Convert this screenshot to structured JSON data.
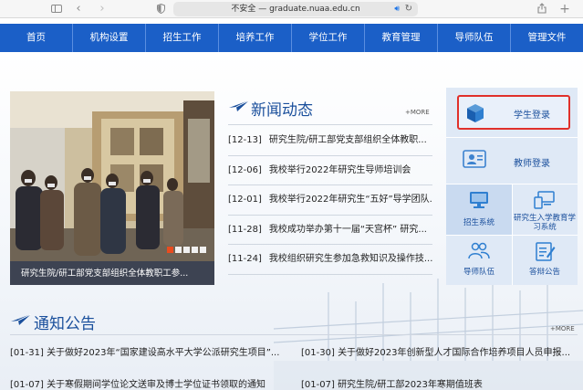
{
  "browser": {
    "security_label": "不安全",
    "separator": "—",
    "domain": "graduate.nuaa.edu.cn"
  },
  "nav": {
    "items": [
      "首页",
      "机构设置",
      "招生工作",
      "培养工作",
      "学位工作",
      "教育管理",
      "导师队伍",
      "管理文件"
    ]
  },
  "carousel": {
    "caption": "研究生院/研工部党支部组织全体教职工参...",
    "slide_count": 5,
    "active_slide": 1
  },
  "news": {
    "title": "新闻动态",
    "more": "+MORE",
    "items": [
      {
        "date": "[12-13]",
        "text": "研究生院/研工部党支部组织全体教职..."
      },
      {
        "date": "[12-06]",
        "text": "我校举行2022年研究生导师培训会"
      },
      {
        "date": "[12-01]",
        "text": "我校举行2022年研究生“五好”导学团队..."
      },
      {
        "date": "[11-28]",
        "text": "我校成功举办第十一届“天宫杯” 研究..."
      },
      {
        "date": "[11-24]",
        "text": "我校组织研究生参加急救知识及操作技..."
      }
    ]
  },
  "quick_links": {
    "student_login": "学生登录",
    "teacher_login": "教师登录",
    "grid": [
      "招生系统",
      "研究生入学教育学习系统",
      "导师队伍",
      "答辩公告"
    ]
  },
  "notices": {
    "title": "通知公告",
    "more": "+MORE",
    "items": [
      {
        "date": "[01-31]",
        "text": "关于做好2023年“国家建设高水平大学公派研究生项目”..."
      },
      {
        "date": "[01-30]",
        "text": "关于做好2023年创新型人才国际合作培养项目人员申报..."
      },
      {
        "date": "[01-07]",
        "text": "关于寒假期间学位论文送审及博士学位证书领取的通知"
      },
      {
        "date": "[01-07]",
        "text": "研究生院/研工部2023年寒期值班表"
      }
    ]
  },
  "colors": {
    "nav_blue": "#1b5fc7",
    "title_blue": "#1a4f9c",
    "highlight_red": "#e0302a",
    "slide_active": "#e94c1f"
  }
}
